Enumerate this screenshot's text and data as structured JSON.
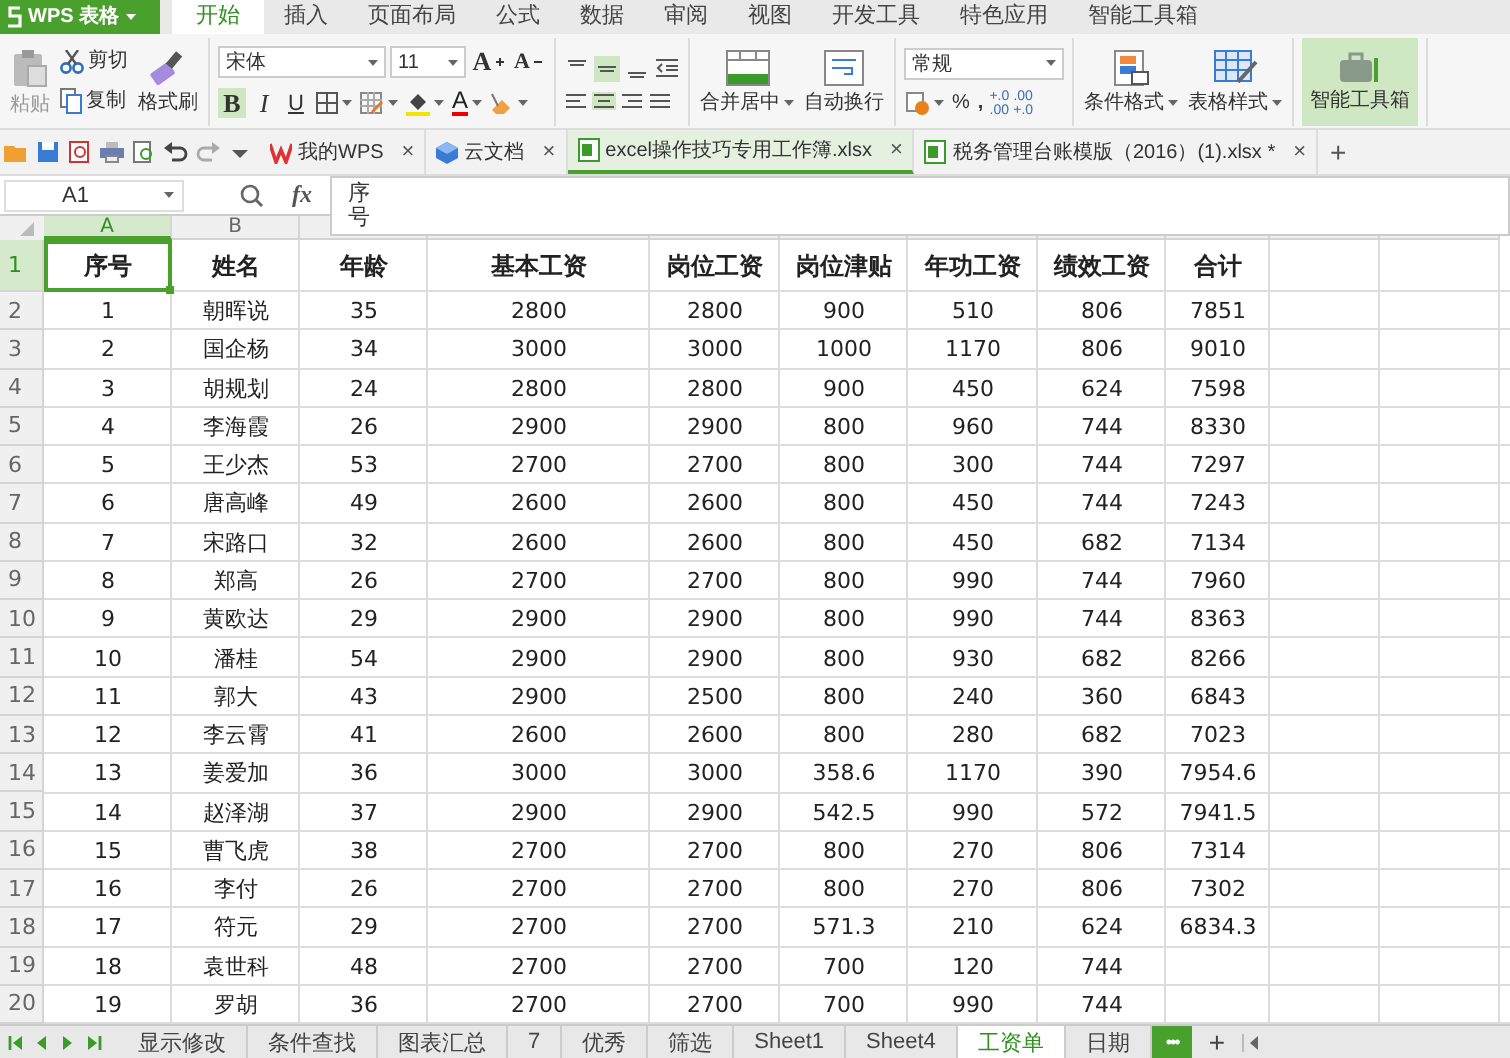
{
  "app": {
    "label": "WPS 表格"
  },
  "menu_tabs": [
    {
      "label": "开始",
      "selected": true
    },
    {
      "label": "插入",
      "selected": false
    },
    {
      "label": "页面布局",
      "selected": false
    },
    {
      "label": "公式",
      "selected": false
    },
    {
      "label": "数据",
      "selected": false
    },
    {
      "label": "审阅",
      "selected": false
    },
    {
      "label": "视图",
      "selected": false
    },
    {
      "label": "开发工具",
      "selected": false
    },
    {
      "label": "特色应用",
      "selected": false
    },
    {
      "label": "智能工具箱",
      "selected": false
    }
  ],
  "ribbon": {
    "paste": {
      "label": "粘贴",
      "disabled": true
    },
    "cut": "剪切",
    "copy": "复制",
    "format_painter": "格式刷",
    "font_name": "宋体",
    "font_size": "11",
    "grow_font": "A",
    "shrink_font": "A",
    "styles": [
      {
        "label": "B",
        "selected": true
      },
      {
        "label": "I",
        "selected": false
      },
      {
        "label": "U",
        "selected": false
      }
    ],
    "font_color": "A",
    "vertical_align": [
      {
        "selected": false
      },
      {
        "selected": true
      },
      {
        "selected": false
      }
    ],
    "horizontal_align": [
      {
        "selected": false
      },
      {
        "selected": true
      },
      {
        "selected": false
      },
      {
        "selected": false
      }
    ],
    "merge_center": "合并居中",
    "wrap_text": "自动换行",
    "number_format": "常规",
    "percent": "%",
    "comma": ",",
    "decimal_buttons": [
      {
        "top": "+.0",
        "bottom": ".00"
      },
      {
        "top": ".00",
        "bottom": "+.0"
      }
    ],
    "conditional_format": "条件格式",
    "table_style": "表格样式",
    "toolbox": {
      "label": "智能工具箱",
      "selected": true
    }
  },
  "doc_tabs": [
    {
      "label": "我的WPS",
      "close": "×",
      "selected": false
    },
    {
      "label": "云文档",
      "close": "×",
      "selected": false
    },
    {
      "label": "excel操作技巧专用工作簿.xlsx",
      "close": "×",
      "selected": true
    },
    {
      "label": "税务管理台账模版（2016）(1).xlsx *",
      "close": "×",
      "selected": false
    }
  ],
  "new_tab": "+",
  "formula_bar": {
    "cell_ref": "A1",
    "fx": "fx",
    "content": "序号"
  },
  "sheet": {
    "columns": [
      {
        "label": "A",
        "selected": true
      },
      {
        "label": "B",
        "selected": false
      }
    ],
    "rows": [
      {
        "number": "1",
        "selected": true,
        "cells": [
          "序号",
          "姓名",
          "年龄",
          "基本工资",
          "岗位工资",
          "岗位津贴",
          "年功工资",
          "绩效工资",
          "合计"
        ]
      },
      {
        "number": "2",
        "selected": false,
        "cells": [
          "1",
          "朝晖说",
          "35",
          "2800",
          "2800",
          "900",
          "510",
          "806",
          "7851"
        ]
      },
      {
        "number": "3",
        "selected": false,
        "cells": [
          "2",
          "国企杨",
          "34",
          "3000",
          "3000",
          "1000",
          "1170",
          "806",
          "9010"
        ]
      },
      {
        "number": "4",
        "selected": false,
        "cells": [
          "3",
          "胡规划",
          "24",
          "2800",
          "2800",
          "900",
          "450",
          "624",
          "7598"
        ]
      },
      {
        "number": "5",
        "selected": false,
        "cells": [
          "4",
          "李海霞",
          "26",
          "2900",
          "2900",
          "800",
          "960",
          "744",
          "8330"
        ]
      },
      {
        "number": "6",
        "selected": false,
        "cells": [
          "5",
          "王少杰",
          "53",
          "2700",
          "2700",
          "800",
          "300",
          "744",
          "7297"
        ]
      },
      {
        "number": "7",
        "selected": false,
        "cells": [
          "6",
          "唐高峰",
          "49",
          "2600",
          "2600",
          "800",
          "450",
          "744",
          "7243"
        ]
      },
      {
        "number": "8",
        "selected": false,
        "cells": [
          "7",
          "宋路口",
          "32",
          "2600",
          "2600",
          "800",
          "450",
          "682",
          "7134"
        ]
      },
      {
        "number": "9",
        "selected": false,
        "cells": [
          "8",
          "郑高",
          "26",
          "2700",
          "2700",
          "800",
          "990",
          "744",
          "7960"
        ]
      },
      {
        "number": "10",
        "selected": false,
        "cells": [
          "9",
          "黄欧达",
          "29",
          "2900",
          "2900",
          "800",
          "990",
          "744",
          "8363"
        ]
      },
      {
        "number": "11",
        "selected": false,
        "cells": [
          "10",
          "潘桂",
          "54",
          "2900",
          "2900",
          "800",
          "930",
          "682",
          "8266"
        ]
      },
      {
        "number": "12",
        "selected": false,
        "cells": [
          "11",
          "郭大",
          "43",
          "2900",
          "2500",
          "800",
          "240",
          "360",
          "6843"
        ]
      },
      {
        "number": "13",
        "selected": false,
        "cells": [
          "12",
          "李云霄",
          "41",
          "2600",
          "2600",
          "800",
          "280",
          "682",
          "7023"
        ]
      },
      {
        "number": "14",
        "selected": false,
        "cells": [
          "13",
          "姜爱加",
          "36",
          "3000",
          "3000",
          "358.6",
          "1170",
          "390",
          "7954.6"
        ]
      },
      {
        "number": "15",
        "selected": false,
        "cells": [
          "14",
          "赵泽湖",
          "37",
          "2900",
          "2900",
          "542.5",
          "990",
          "572",
          "7941.5"
        ]
      },
      {
        "number": "16",
        "selected": false,
        "cells": [
          "15",
          "曹飞虎",
          "38",
          "2700",
          "2700",
          "800",
          "270",
          "806",
          "7314"
        ]
      },
      {
        "number": "17",
        "selected": false,
        "cells": [
          "16",
          "李付",
          "26",
          "2700",
          "2700",
          "800",
          "270",
          "806",
          "7302"
        ]
      },
      {
        "number": "18",
        "selected": false,
        "cells": [
          "17",
          "符元",
          "29",
          "2700",
          "2700",
          "571.3",
          "210",
          "624",
          "6834.3"
        ]
      },
      {
        "number": "19",
        "selected": false,
        "cells": [
          "18",
          "袁世科",
          "48",
          "2700",
          "2700",
          "700",
          "120",
          "744"
        ]
      },
      {
        "number": "20",
        "selected": false,
        "cells": [
          "19",
          "罗胡",
          "36",
          "2700",
          "2700",
          "700",
          "990",
          "744"
        ]
      }
    ]
  },
  "sheet_tabs": [
    {
      "label": "显示修改",
      "selected": false
    },
    {
      "label": "条件查找",
      "selected": false
    },
    {
      "label": "图表汇总",
      "selected": false
    },
    {
      "label": "7",
      "selected": false
    },
    {
      "label": "优秀",
      "selected": false
    },
    {
      "label": "筛选",
      "selected": false
    },
    {
      "label": "Sheet1",
      "selected": false
    },
    {
      "label": "Sheet4",
      "selected": false
    },
    {
      "label": "工资单",
      "selected": true
    },
    {
      "label": "日期",
      "selected": false
    }
  ],
  "more_sheets": "•••",
  "add_sheet": "+"
}
